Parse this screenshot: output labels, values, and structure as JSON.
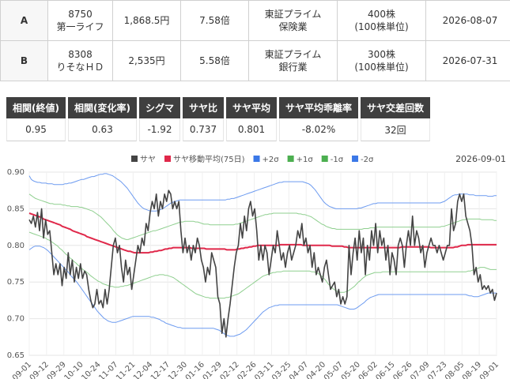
{
  "pairs": [
    {
      "label": "A",
      "code": "8750",
      "name": "第一ライフ",
      "price": "1,868.5円",
      "per": "7.58倍",
      "market": "東証プライム",
      "sector": "保険業",
      "qty": "400株",
      "unit": "(100株単位)",
      "date": "2026-08-07"
    },
    {
      "label": "B",
      "code": "8308",
      "name": "りそなＨＤ",
      "price": "2,535円",
      "per": "5.58倍",
      "market": "東証プライム",
      "sector": "銀行業",
      "qty": "300株",
      "unit": "(100株単位)",
      "date": "2026-07-31"
    }
  ],
  "stats": {
    "headers": [
      "相関(終値)",
      "相関(変化率)",
      "シグマ",
      "サヤ比",
      "サヤ平均",
      "サヤ平均乖離率",
      "サヤ交差回数"
    ],
    "values": [
      "0.95",
      "0.63",
      "-1.92",
      "0.737",
      "0.801",
      "-8.02%",
      "32回"
    ]
  },
  "chart_data": {
    "type": "line",
    "date_label": "2026-09-01",
    "legend": [
      {
        "name": "サヤ",
        "color": "#444444"
      },
      {
        "name": "サヤ移動平均(75日)",
        "color": "#e0284a"
      },
      {
        "name": "+2σ",
        "color": "#3b78e7"
      },
      {
        "name": "+1σ",
        "color": "#4caf50"
      },
      {
        "name": "-1σ",
        "color": "#4caf50"
      },
      {
        "name": "-2σ",
        "color": "#3b78e7"
      }
    ],
    "y_ticks": [
      "0.90",
      "0.85",
      "0.80",
      "0.75",
      "0.70",
      "0.65"
    ],
    "ylim": [
      0.65,
      0.9
    ],
    "x_ticks": [
      "09-01",
      "09-12",
      "09-29",
      "10-10",
      "10-24",
      "11-07",
      "11-21",
      "12-04",
      "12-17",
      "12-30",
      "01-16",
      "01-29",
      "02-12",
      "02-26",
      "03-11",
      "03-25",
      "04-07",
      "04-20",
      "05-07",
      "05-20",
      "06-02",
      "06-15",
      "06-26",
      "07-09",
      "07-23",
      "08-05",
      "08-19",
      "09-01"
    ],
    "saya": [
      0.835,
      0.83,
      0.84,
      0.825,
      0.845,
      0.82,
      0.85,
      0.81,
      0.835,
      0.815,
      0.82,
      0.79,
      0.76,
      0.775,
      0.76,
      0.775,
      0.745,
      0.77,
      0.755,
      0.79,
      0.76,
      0.78,
      0.75,
      0.77,
      0.755,
      0.775,
      0.755,
      0.765,
      0.76,
      0.74,
      0.725,
      0.715,
      0.72,
      0.74,
      0.72,
      0.725,
      0.715,
      0.74,
      0.72,
      0.74,
      0.77,
      0.8,
      0.81,
      0.79,
      0.8,
      0.77,
      0.75,
      0.78,
      0.76,
      0.77,
      0.74,
      0.76,
      0.78,
      0.8,
      0.79,
      0.81,
      0.8,
      0.83,
      0.82,
      0.845,
      0.86,
      0.85,
      0.87,
      0.84,
      0.86,
      0.85,
      0.87,
      0.86,
      0.875,
      0.87,
      0.85,
      0.86,
      0.85,
      0.86,
      0.82,
      0.79,
      0.81,
      0.79,
      0.8,
      0.78,
      0.8,
      0.79,
      0.81,
      0.8,
      0.78,
      0.77,
      0.75,
      0.77,
      0.76,
      0.79,
      0.78,
      0.77,
      0.73,
      0.72,
      0.68,
      0.7,
      0.675,
      0.7,
      0.72,
      0.745,
      0.77,
      0.79,
      0.8,
      0.83,
      0.81,
      0.84,
      0.82,
      0.85,
      0.86,
      0.84,
      0.85,
      0.82,
      0.78,
      0.8,
      0.78,
      0.8,
      0.79,
      0.76,
      0.78,
      0.8,
      0.79,
      0.82,
      0.8,
      0.78,
      0.79,
      0.77,
      0.79,
      0.8,
      0.78,
      0.79,
      0.8,
      0.82,
      0.81,
      0.83,
      0.8,
      0.81,
      0.79,
      0.8,
      0.77,
      0.79,
      0.76,
      0.77,
      0.76,
      0.75,
      0.77,
      0.78,
      0.76,
      0.74,
      0.745,
      0.75,
      0.73,
      0.74,
      0.72,
      0.73,
      0.72,
      0.73,
      0.8,
      0.76,
      0.79,
      0.81,
      0.78,
      0.82,
      0.79,
      0.81,
      0.76,
      0.8,
      0.78,
      0.82,
      0.8,
      0.83,
      0.79,
      0.82,
      0.8,
      0.81,
      0.78,
      0.8,
      0.76,
      0.79,
      0.78,
      0.76,
      0.8,
      0.81,
      0.8,
      0.77,
      0.8,
      0.82,
      0.8,
      0.84,
      0.8,
      0.82,
      0.81,
      0.79,
      0.8,
      0.77,
      0.79,
      0.8,
      0.81,
      0.8,
      0.8,
      0.79,
      0.8,
      0.79,
      0.78,
      0.79,
      0.8,
      0.8,
      0.85,
      0.82,
      0.83,
      0.86,
      0.87,
      0.86,
      0.87,
      0.84,
      0.83,
      0.82,
      0.8,
      0.76,
      0.77,
      0.75,
      0.76,
      0.74,
      0.745,
      0.74,
      0.745,
      0.735,
      0.74,
      0.725,
      0.735
    ],
    "ma75": [
      0.844,
      0.843,
      0.842,
      0.841,
      0.84,
      0.839,
      0.838,
      0.836,
      0.835,
      0.834,
      0.833,
      0.832,
      0.831,
      0.83,
      0.829,
      0.828,
      0.826,
      0.825,
      0.824,
      0.823,
      0.822,
      0.82,
      0.819,
      0.818,
      0.817,
      0.816,
      0.815,
      0.814,
      0.812,
      0.811,
      0.81,
      0.809,
      0.808,
      0.807,
      0.806,
      0.805,
      0.804,
      0.803,
      0.802,
      0.801,
      0.8,
      0.799,
      0.798,
      0.797,
      0.796,
      0.795,
      0.794,
      0.793,
      0.792,
      0.792,
      0.791,
      0.79,
      0.79,
      0.79,
      0.79,
      0.79,
      0.79,
      0.79,
      0.79,
      0.791,
      0.791,
      0.792,
      0.792,
      0.793,
      0.793,
      0.794,
      0.795,
      0.795,
      0.796,
      0.796,
      0.797,
      0.797,
      0.797,
      0.797,
      0.797,
      0.797,
      0.797,
      0.797,
      0.797,
      0.796,
      0.796,
      0.796,
      0.796,
      0.796,
      0.796,
      0.796,
      0.795,
      0.795,
      0.795,
      0.795,
      0.795,
      0.795,
      0.795,
      0.795,
      0.795,
      0.795,
      0.794,
      0.794,
      0.794,
      0.794,
      0.794,
      0.795,
      0.795,
      0.796,
      0.796,
      0.797,
      0.797,
      0.798,
      0.798,
      0.799,
      0.799,
      0.8,
      0.8,
      0.8,
      0.8,
      0.8,
      0.8,
      0.8,
      0.8,
      0.8,
      0.8,
      0.8,
      0.801,
      0.801,
      0.801,
      0.801,
      0.801,
      0.801,
      0.801,
      0.801,
      0.801,
      0.801,
      0.801,
      0.8,
      0.8,
      0.8,
      0.8,
      0.8,
      0.8,
      0.8,
      0.8,
      0.8,
      0.8,
      0.8,
      0.8,
      0.8,
      0.8,
      0.799,
      0.799,
      0.799,
      0.799,
      0.799,
      0.799,
      0.798,
      0.798,
      0.797,
      0.797,
      0.797,
      0.797,
      0.797,
      0.797,
      0.797,
      0.797,
      0.797,
      0.797,
      0.797,
      0.797,
      0.797,
      0.797,
      0.797,
      0.797,
      0.797,
      0.797,
      0.797,
      0.797,
      0.797,
      0.797,
      0.797,
      0.797,
      0.797,
      0.797,
      0.798,
      0.798,
      0.798,
      0.798,
      0.798,
      0.798,
      0.798,
      0.798,
      0.798,
      0.798,
      0.798,
      0.798,
      0.798,
      0.798,
      0.797,
      0.797,
      0.797,
      0.797,
      0.797,
      0.797,
      0.797,
      0.797,
      0.797,
      0.797,
      0.797,
      0.797,
      0.798,
      0.798,
      0.799,
      0.8,
      0.8,
      0.8,
      0.801,
      0.801,
      0.801,
      0.801,
      0.801,
      0.801,
      0.801,
      0.801,
      0.801,
      0.801,
      0.801,
      0.801,
      0.801,
      0.801,
      0.801
    ],
    "plus2": [
      0.895,
      0.89,
      0.888,
      0.887,
      0.886,
      0.886,
      0.885,
      0.885,
      0.885,
      0.884,
      0.884,
      0.884,
      0.883,
      0.883,
      0.883,
      0.883,
      0.883,
      0.884,
      0.884,
      0.885,
      0.885,
      0.886,
      0.887,
      0.888,
      0.889,
      0.89,
      0.89,
      0.891,
      0.892,
      0.893,
      0.894,
      0.894,
      0.895,
      0.896,
      0.897,
      0.897,
      0.898,
      0.898,
      0.897,
      0.896,
      0.895,
      0.893,
      0.891,
      0.889,
      0.887,
      0.884,
      0.881,
      0.878,
      0.874,
      0.87,
      0.866,
      0.862,
      0.858,
      0.855,
      0.852,
      0.85,
      0.849,
      0.848,
      0.847,
      0.847,
      0.847,
      0.847,
      0.848,
      0.849,
      0.85,
      0.852,
      0.854,
      0.856,
      0.858,
      0.859,
      0.86,
      0.861,
      0.862,
      0.862,
      0.862,
      0.862,
      0.862,
      0.862,
      0.862,
      0.862,
      0.862,
      0.862,
      0.862,
      0.862,
      0.862,
      0.862,
      0.862,
      0.862,
      0.862,
      0.862,
      0.862,
      0.862,
      0.862,
      0.862,
      0.862,
      0.863,
      0.863,
      0.864,
      0.864,
      0.865,
      0.866,
      0.867,
      0.868,
      0.869,
      0.87,
      0.871,
      0.872,
      0.873,
      0.874,
      0.875,
      0.876,
      0.877,
      0.878,
      0.879,
      0.88,
      0.881,
      0.882,
      0.883,
      0.884,
      0.885,
      0.886,
      0.886,
      0.887,
      0.887,
      0.887,
      0.887,
      0.887,
      0.887,
      0.887,
      0.887,
      0.887,
      0.887,
      0.886,
      0.885,
      0.884,
      0.882,
      0.879,
      0.876,
      0.872,
      0.868,
      0.864,
      0.86,
      0.857,
      0.855,
      0.853,
      0.852,
      0.851,
      0.85,
      0.85,
      0.85,
      0.85,
      0.85,
      0.85,
      0.85,
      0.85,
      0.85,
      0.85,
      0.85,
      0.851,
      0.851,
      0.852,
      0.853,
      0.854,
      0.855,
      0.856,
      0.857,
      0.857,
      0.858,
      0.858,
      0.858,
      0.858,
      0.858,
      0.858,
      0.858,
      0.858,
      0.858,
      0.858,
      0.858,
      0.858,
      0.858,
      0.858,
      0.858,
      0.858,
      0.858,
      0.858,
      0.858,
      0.858,
      0.858,
      0.858,
      0.858,
      0.858,
      0.858,
      0.858,
      0.858,
      0.858,
      0.858,
      0.858,
      0.858,
      0.859,
      0.86,
      0.862,
      0.864,
      0.866,
      0.868,
      0.869,
      0.869,
      0.87,
      0.87,
      0.87,
      0.87,
      0.87,
      0.869,
      0.869,
      0.869,
      0.868,
      0.868,
      0.868,
      0.868,
      0.868,
      0.868,
      0.867,
      0.867,
      0.867,
      0.868,
      0.868
    ],
    "plus1": [
      0.87,
      0.868,
      0.866,
      0.864,
      0.863,
      0.862,
      0.861,
      0.86,
      0.859,
      0.858,
      0.857,
      0.857,
      0.856,
      0.856,
      0.856,
      0.856,
      0.855,
      0.855,
      0.854,
      0.854,
      0.853,
      0.853,
      0.853,
      0.853,
      0.852,
      0.852,
      0.851,
      0.85,
      0.849,
      0.848,
      0.847,
      0.845,
      0.843,
      0.841,
      0.839,
      0.836,
      0.833,
      0.83,
      0.827,
      0.824,
      0.82,
      0.817,
      0.814,
      0.812,
      0.81,
      0.809,
      0.808,
      0.808,
      0.809,
      0.81,
      0.811,
      0.812,
      0.813,
      0.814,
      0.815,
      0.816,
      0.817,
      0.818,
      0.819,
      0.82,
      0.82,
      0.821,
      0.822,
      0.823,
      0.824,
      0.825,
      0.826,
      0.827,
      0.828,
      0.829,
      0.83,
      0.831,
      0.832,
      0.832,
      0.833,
      0.833,
      0.833,
      0.833,
      0.833,
      0.832,
      0.832,
      0.831,
      0.83,
      0.829,
      0.829,
      0.829,
      0.828,
      0.828,
      0.828,
      0.828,
      0.828,
      0.828,
      0.828,
      0.828,
      0.828,
      0.828,
      0.828,
      0.828,
      0.829,
      0.829,
      0.83,
      0.831,
      0.832,
      0.833,
      0.834,
      0.835,
      0.836,
      0.837,
      0.838,
      0.839,
      0.84,
      0.841,
      0.842,
      0.842,
      0.843,
      0.843,
      0.844,
      0.844,
      0.844,
      0.844,
      0.844,
      0.844,
      0.844,
      0.844,
      0.844,
      0.844,
      0.844,
      0.844,
      0.843,
      0.843,
      0.842,
      0.842,
      0.841,
      0.84,
      0.839,
      0.837,
      0.835,
      0.833,
      0.831,
      0.829,
      0.828,
      0.826,
      0.825,
      0.824,
      0.823,
      0.823,
      0.822,
      0.822,
      0.822,
      0.822,
      0.822,
      0.822,
      0.822,
      0.822,
      0.822,
      0.822,
      0.822,
      0.822,
      0.822,
      0.823,
      0.823,
      0.823,
      0.824,
      0.824,
      0.824,
      0.825,
      0.825,
      0.825,
      0.825,
      0.825,
      0.825,
      0.825,
      0.825,
      0.825,
      0.825,
      0.825,
      0.825,
      0.825,
      0.825,
      0.825,
      0.825,
      0.825,
      0.825,
      0.825,
      0.825,
      0.825,
      0.825,
      0.825,
      0.825,
      0.825,
      0.825,
      0.825,
      0.825,
      0.825,
      0.825,
      0.825,
      0.826,
      0.826,
      0.827,
      0.828,
      0.829,
      0.83,
      0.831,
      0.832,
      0.833,
      0.834,
      0.835,
      0.835,
      0.836,
      0.836,
      0.836,
      0.836,
      0.836,
      0.836,
      0.836,
      0.835,
      0.835,
      0.835,
      0.835,
      0.835,
      0.835,
      0.834,
      0.834
    ],
    "minus1": [
      0.818,
      0.817,
      0.816,
      0.815,
      0.814,
      0.813,
      0.812,
      0.811,
      0.81,
      0.808,
      0.807,
      0.805,
      0.803,
      0.801,
      0.799,
      0.796,
      0.794,
      0.791,
      0.788,
      0.786,
      0.783,
      0.781,
      0.778,
      0.776,
      0.773,
      0.771,
      0.768,
      0.766,
      0.764,
      0.762,
      0.759,
      0.757,
      0.755,
      0.753,
      0.751,
      0.75,
      0.748,
      0.747,
      0.746,
      0.745,
      0.744,
      0.744,
      0.743,
      0.743,
      0.743,
      0.744,
      0.744,
      0.745,
      0.745,
      0.746,
      0.747,
      0.748,
      0.749,
      0.75,
      0.751,
      0.752,
      0.753,
      0.754,
      0.755,
      0.756,
      0.757,
      0.758,
      0.759,
      0.759,
      0.76,
      0.76,
      0.76,
      0.759,
      0.759,
      0.758,
      0.757,
      0.756,
      0.754,
      0.752,
      0.75,
      0.748,
      0.746,
      0.744,
      0.742,
      0.74,
      0.738,
      0.736,
      0.734,
      0.733,
      0.732,
      0.731,
      0.73,
      0.729,
      0.729,
      0.728,
      0.728,
      0.728,
      0.728,
      0.728,
      0.728,
      0.728,
      0.728,
      0.729,
      0.729,
      0.73,
      0.731,
      0.732,
      0.733,
      0.734,
      0.736,
      0.738,
      0.74,
      0.742,
      0.744,
      0.746,
      0.748,
      0.75,
      0.752,
      0.754,
      0.756,
      0.758,
      0.759,
      0.76,
      0.761,
      0.762,
      0.763,
      0.763,
      0.764,
      0.764,
      0.764,
      0.765,
      0.765,
      0.765,
      0.765,
      0.765,
      0.765,
      0.765,
      0.765,
      0.765,
      0.765,
      0.765,
      0.765,
      0.765,
      0.765,
      0.764,
      0.764,
      0.763,
      0.762,
      0.76,
      0.758,
      0.755,
      0.752,
      0.748,
      0.745,
      0.742,
      0.74,
      0.738,
      0.737,
      0.736,
      0.736,
      0.736,
      0.737,
      0.738,
      0.74,
      0.742,
      0.744,
      0.747,
      0.75,
      0.752,
      0.755,
      0.757,
      0.759,
      0.76,
      0.761,
      0.762,
      0.763,
      0.763,
      0.763,
      0.763,
      0.764,
      0.764,
      0.764,
      0.764,
      0.764,
      0.764,
      0.764,
      0.764,
      0.764,
      0.764,
      0.764,
      0.764,
      0.764,
      0.764,
      0.764,
      0.764,
      0.764,
      0.764,
      0.764,
      0.764,
      0.764,
      0.764,
      0.764,
      0.764,
      0.764,
      0.764,
      0.764,
      0.764,
      0.764,
      0.764,
      0.764,
      0.764,
      0.764,
      0.764,
      0.764,
      0.764,
      0.764,
      0.764,
      0.764,
      0.764,
      0.764,
      0.764,
      0.765,
      0.765,
      0.766,
      0.767,
      0.768,
      0.769,
      0.77,
      0.77,
      0.77,
      0.769,
      0.768,
      0.767,
      0.767,
      0.767,
      0.767
    ],
    "minus2": [
      0.794,
      0.796,
      0.798,
      0.799,
      0.799,
      0.799,
      0.798,
      0.797,
      0.795,
      0.793,
      0.79,
      0.787,
      0.784,
      0.781,
      0.778,
      0.775,
      0.772,
      0.769,
      0.766,
      0.763,
      0.759,
      0.756,
      0.753,
      0.75,
      0.746,
      0.742,
      0.738,
      0.734,
      0.73,
      0.726,
      0.722,
      0.718,
      0.714,
      0.71,
      0.707,
      0.704,
      0.701,
      0.699,
      0.697,
      0.696,
      0.695,
      0.695,
      0.695,
      0.696,
      0.697,
      0.698,
      0.699,
      0.7,
      0.701,
      0.702,
      0.703,
      0.703,
      0.703,
      0.703,
      0.703,
      0.703,
      0.703,
      0.703,
      0.703,
      0.702,
      0.702,
      0.701,
      0.7,
      0.699,
      0.697,
      0.696,
      0.694,
      0.693,
      0.692,
      0.691,
      0.69,
      0.689,
      0.688,
      0.688,
      0.687,
      0.687,
      0.687,
      0.687,
      0.687,
      0.687,
      0.687,
      0.687,
      0.687,
      0.687,
      0.687,
      0.687,
      0.687,
      0.687,
      0.687,
      0.687,
      0.686,
      0.685,
      0.684,
      0.682,
      0.68,
      0.678,
      0.677,
      0.676,
      0.676,
      0.676,
      0.677,
      0.678,
      0.679,
      0.681,
      0.683,
      0.685,
      0.688,
      0.691,
      0.694,
      0.697,
      0.7,
      0.703,
      0.706,
      0.709,
      0.711,
      0.713,
      0.715,
      0.716,
      0.717,
      0.718,
      0.718,
      0.719,
      0.719,
      0.719,
      0.719,
      0.719,
      0.719,
      0.719,
      0.719,
      0.719,
      0.719,
      0.719,
      0.719,
      0.719,
      0.719,
      0.719,
      0.719,
      0.719,
      0.719,
      0.719,
      0.719,
      0.719,
      0.719,
      0.719,
      0.719,
      0.719,
      0.719,
      0.719,
      0.719,
      0.719,
      0.718,
      0.717,
      0.716,
      0.715,
      0.714,
      0.713,
      0.713,
      0.713,
      0.714,
      0.716,
      0.718,
      0.72,
      0.722,
      0.725,
      0.727,
      0.729,
      0.73,
      0.731,
      0.732,
      0.733,
      0.733,
      0.733,
      0.733,
      0.733,
      0.733,
      0.733,
      0.733,
      0.733,
      0.733,
      0.733,
      0.733,
      0.733,
      0.733,
      0.733,
      0.733,
      0.733,
      0.733,
      0.733,
      0.733,
      0.733,
      0.733,
      0.733,
      0.733,
      0.733,
      0.733,
      0.733,
      0.733,
      0.733,
      0.733,
      0.733,
      0.733,
      0.733,
      0.733,
      0.733,
      0.733,
      0.733,
      0.733,
      0.733,
      0.733,
      0.733,
      0.733,
      0.733,
      0.732,
      0.731,
      0.731,
      0.73,
      0.73,
      0.73,
      0.731,
      0.732,
      0.733,
      0.734,
      0.735,
      0.735,
      0.735,
      0.735,
      0.735
    ]
  }
}
